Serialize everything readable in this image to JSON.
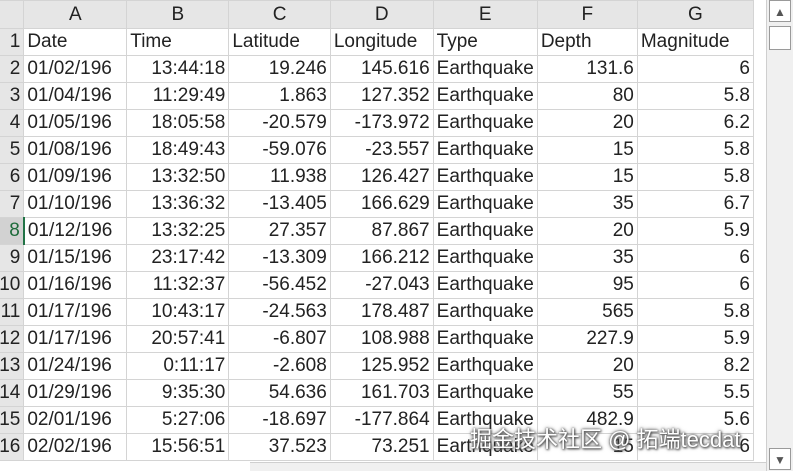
{
  "columns": [
    "A",
    "B",
    "C",
    "D",
    "E",
    "F",
    "G"
  ],
  "rows": [
    {
      "n": "1",
      "cells": [
        "Date",
        "Time",
        "Latitude",
        "Longitude",
        "Type",
        "Depth",
        "Magnitude"
      ]
    },
    {
      "n": "2",
      "cells": [
        "01/02/196",
        "13:44:18",
        "19.246",
        "145.616",
        "Earthquake",
        "131.6",
        "6"
      ]
    },
    {
      "n": "3",
      "cells": [
        "01/04/196",
        "11:29:49",
        "1.863",
        "127.352",
        "Earthquake",
        "80",
        "5.8"
      ]
    },
    {
      "n": "4",
      "cells": [
        "01/05/196",
        "18:05:58",
        "-20.579",
        "-173.972",
        "Earthquake",
        "20",
        "6.2"
      ]
    },
    {
      "n": "5",
      "cells": [
        "01/08/196",
        "18:49:43",
        "-59.076",
        "-23.557",
        "Earthquake",
        "15",
        "5.8"
      ]
    },
    {
      "n": "6",
      "cells": [
        "01/09/196",
        "13:32:50",
        "11.938",
        "126.427",
        "Earthquake",
        "15",
        "5.8"
      ]
    },
    {
      "n": "7",
      "cells": [
        "01/10/196",
        "13:36:32",
        "-13.405",
        "166.629",
        "Earthquake",
        "35",
        "6.7"
      ]
    },
    {
      "n": "8",
      "cells": [
        "01/12/196",
        "13:32:25",
        "27.357",
        "87.867",
        "Earthquake",
        "20",
        "5.9"
      ]
    },
    {
      "n": "9",
      "cells": [
        "01/15/196",
        "23:17:42",
        "-13.309",
        "166.212",
        "Earthquake",
        "35",
        "6"
      ]
    },
    {
      "n": "10",
      "cells": [
        "01/16/196",
        "11:32:37",
        "-56.452",
        "-27.043",
        "Earthquake",
        "95",
        "6"
      ]
    },
    {
      "n": "11",
      "cells": [
        "01/17/196",
        "10:43:17",
        "-24.563",
        "178.487",
        "Earthquake",
        "565",
        "5.8"
      ]
    },
    {
      "n": "12",
      "cells": [
        "01/17/196",
        "20:57:41",
        "-6.807",
        "108.988",
        "Earthquake",
        "227.9",
        "5.9"
      ]
    },
    {
      "n": "13",
      "cells": [
        "01/24/196",
        "0:11:17",
        "-2.608",
        "125.952",
        "Earthquake",
        "20",
        "8.2"
      ]
    },
    {
      "n": "14",
      "cells": [
        "01/29/196",
        "9:35:30",
        "54.636",
        "161.703",
        "Earthquake",
        "55",
        "5.5"
      ]
    },
    {
      "n": "15",
      "cells": [
        "02/01/196",
        "5:27:06",
        "-18.697",
        "-177.864",
        "Earthquake",
        "482.9",
        "5.6"
      ]
    },
    {
      "n": "16",
      "cells": [
        "02/02/196",
        "15:56:51",
        "37.523",
        "73.251",
        "Earthquake",
        "15",
        "6"
      ]
    }
  ],
  "active_row": "8",
  "watermark": "掘金技术社区 @ 拓端tecdat",
  "scrollbar": {
    "up_icon": "▲",
    "down_icon": "▼"
  }
}
